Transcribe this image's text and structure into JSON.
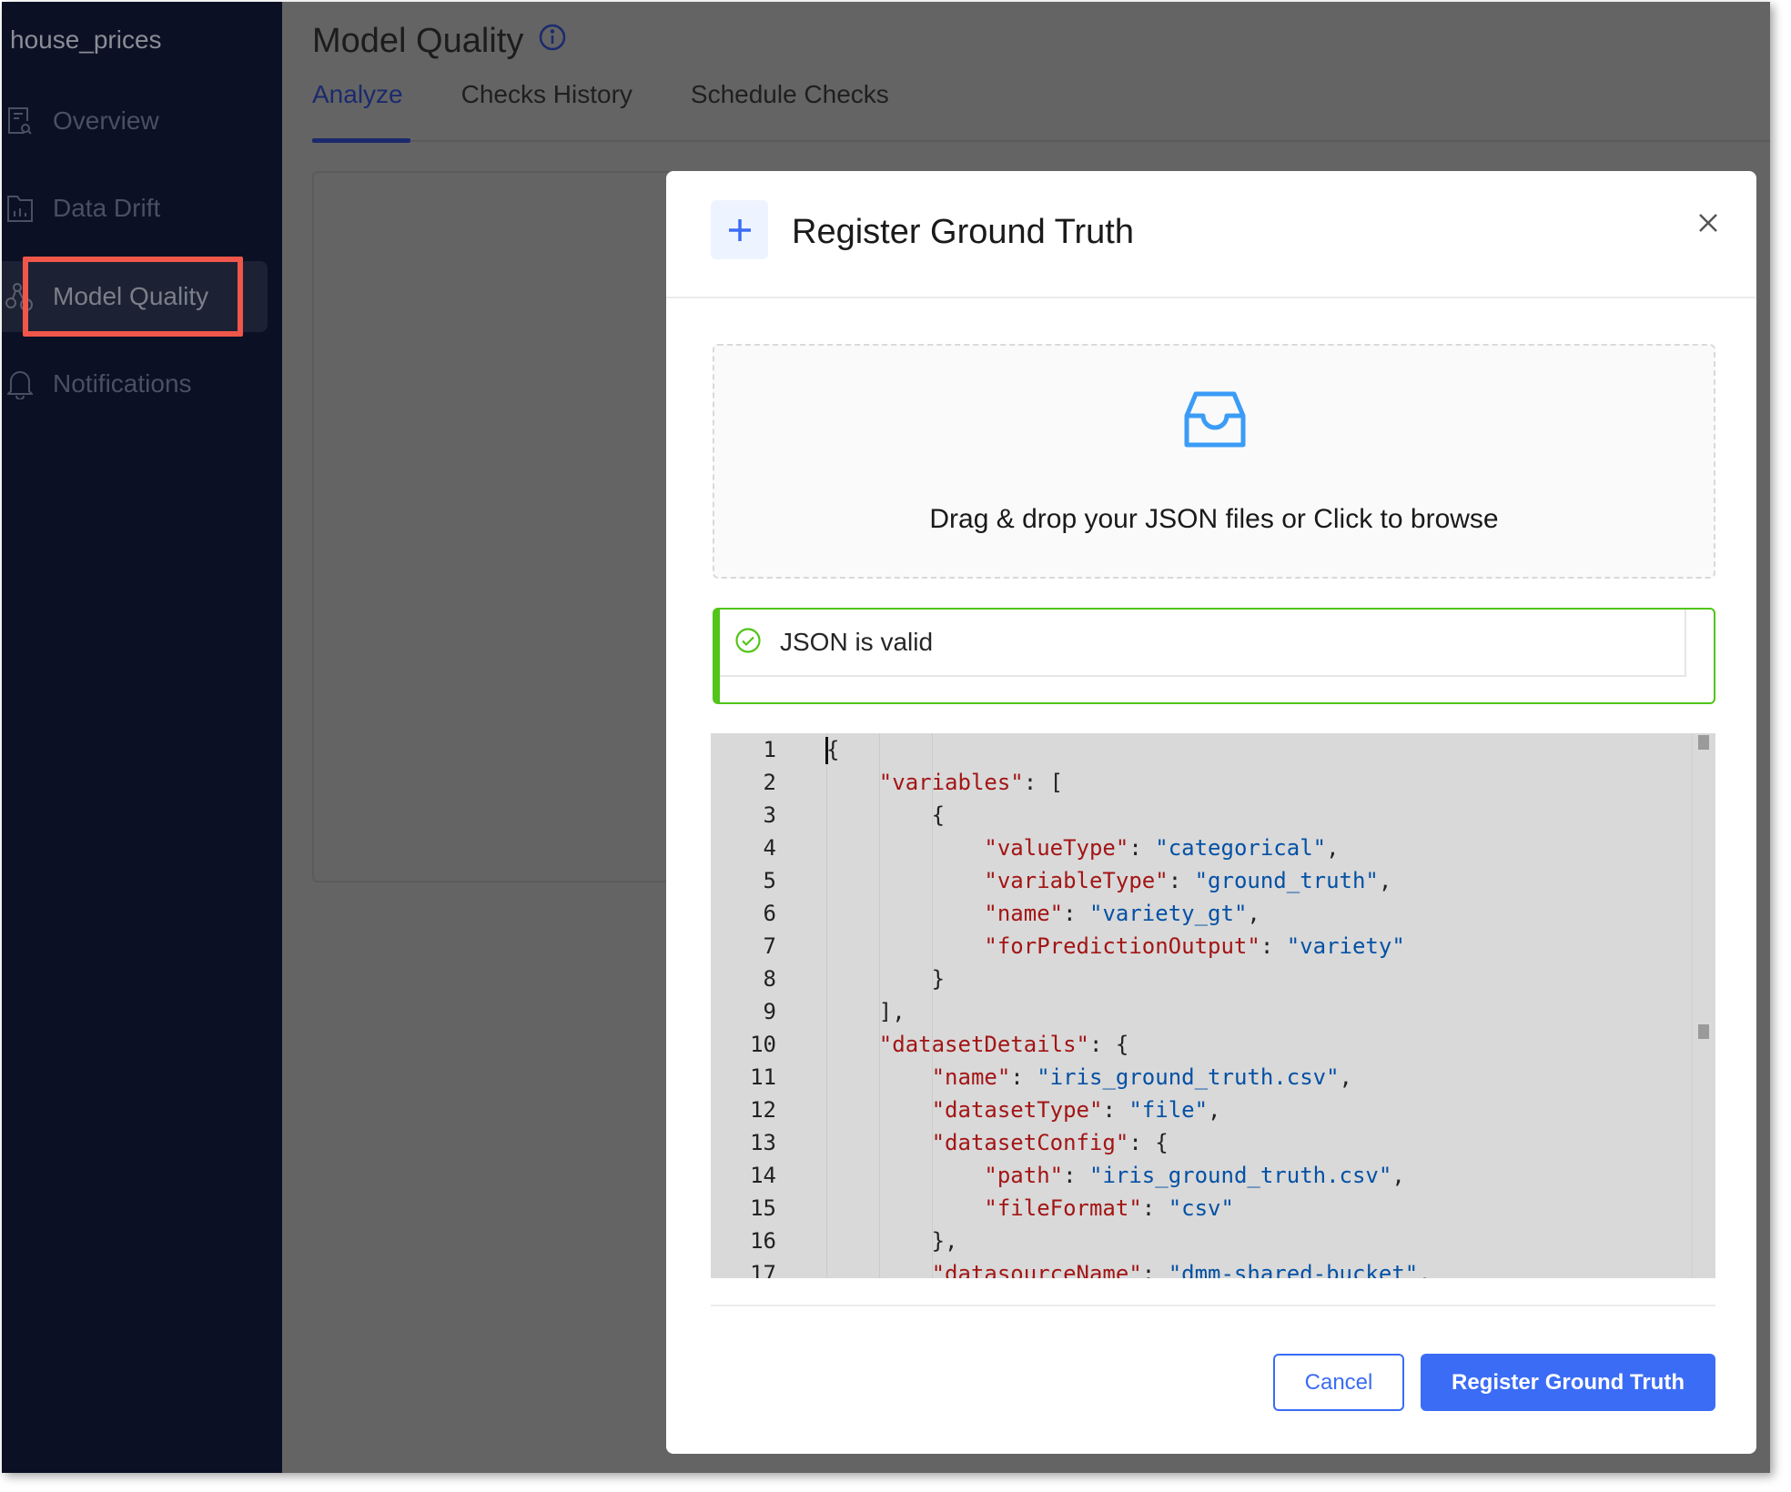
{
  "sidebar": {
    "project": "house_prices",
    "items": [
      {
        "label": "Overview",
        "icon": "document-search-icon"
      },
      {
        "label": "Data Drift",
        "icon": "bar-chart-file-icon"
      },
      {
        "label": "Model Quality",
        "icon": "nodes-icon",
        "active": true
      },
      {
        "label": "Notifications",
        "icon": "bell-icon"
      }
    ],
    "highlight_color": "#f0564a"
  },
  "header": {
    "title": "Model Quality",
    "info_icon": "info-circle-icon"
  },
  "tabs": [
    {
      "label": "Analyze",
      "active": true
    },
    {
      "label": "Checks History"
    },
    {
      "label": "Schedule Checks"
    }
  ],
  "modal": {
    "title": "Register Ground Truth",
    "title_icon": "plus-icon",
    "close_icon": "close-icon",
    "dropzone": {
      "icon": "inbox-icon",
      "text": "Drag & drop your JSON files or Click to browse"
    },
    "alert": {
      "icon": "check-circle-icon",
      "text": "JSON is valid",
      "color": "#52c41a"
    },
    "editor": {
      "lines": [
        "{",
        "    \"variables\": [",
        "        {",
        "            \"valueType\": \"categorical\",",
        "            \"variableType\": \"ground_truth\",",
        "            \"name\": \"variety_gt\",",
        "            \"forPredictionOutput\": \"variety\"",
        "        }",
        "    ],",
        "    \"datasetDetails\": {",
        "        \"name\": \"iris_ground_truth.csv\",",
        "        \"datasetType\": \"file\",",
        "        \"datasetConfig\": {",
        "            \"path\": \"iris_ground_truth.csv\",",
        "            \"fileFormat\": \"csv\"",
        "        },",
        "        \"datasourceName\": \"dmm-shared-bucket\","
      ]
    },
    "cancel_label": "Cancel",
    "submit_label": "Register Ground Truth",
    "accent": "#3b6cf6"
  }
}
